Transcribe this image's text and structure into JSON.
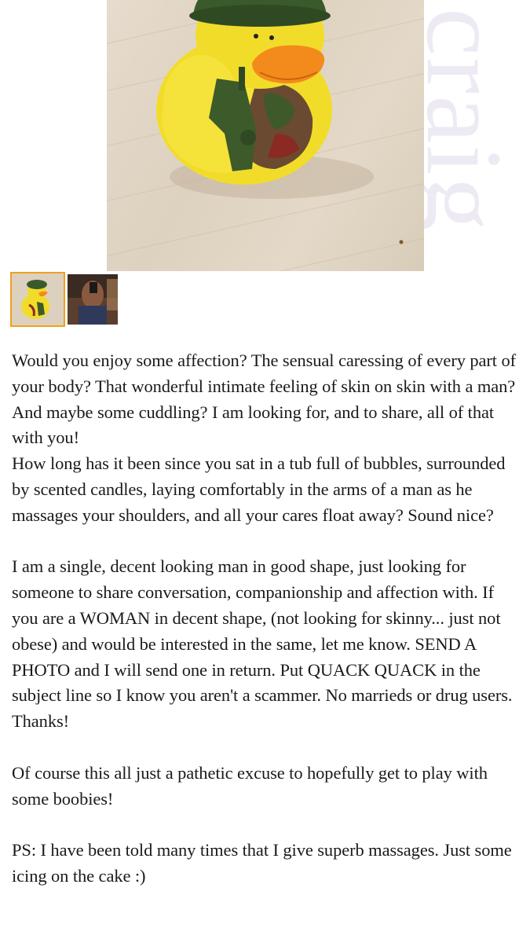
{
  "watermark": "craig",
  "images": {
    "main_alt": "rubber duck in army helmet holding a walkie-talkie",
    "thumbs": [
      {
        "label": "thumbnail-duck",
        "selected": true
      },
      {
        "label": "thumbnail-mirror-selfie",
        "selected": false
      }
    ]
  },
  "post": {
    "p1": "Would you enjoy some affection? The sensual caressing of every part of your body? That wonderful intimate feeling of skin on skin with a man? And maybe some cuddling? I am looking for, and to share, all of that with you!",
    "p2": "How long has it been since you sat in a tub full of bubbles, surrounded by scented candles, laying comfortably in the arms of a man as he massages your shoulders, and all your cares float away? Sound nice?",
    "p3": "I am a single, decent looking man in good shape, just looking for someone to share conversation, companionship and affection with. If you are a WOMAN in decent shape, (not looking for skinny... just not obese) and would be interested in the same, let me know. SEND A PHOTO and I will send one in return. Put QUACK QUACK in the subject line so I know you aren't a scammer. No marrieds or drug users. Thanks!",
    "p4": "Of course this all just a pathetic excuse to hopefully get to play with some boobies!",
    "p5": "PS: I have been told many times that I give superb massages. Just some icing on the cake :)"
  },
  "colors": {
    "thumb_selected_border": "#f0a020",
    "watermark": "#eeeaf4",
    "text": "#1a1a1a"
  }
}
